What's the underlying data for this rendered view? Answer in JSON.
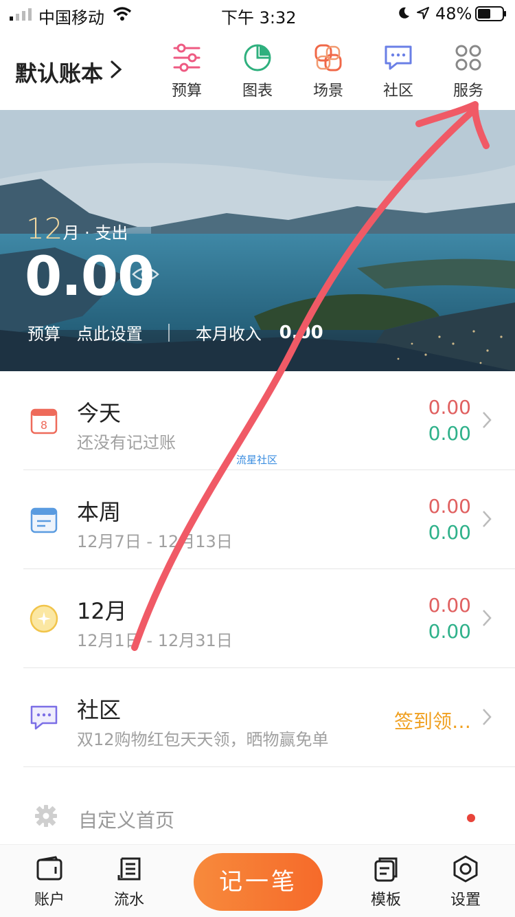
{
  "status_bar": {
    "carrier": "中国移动",
    "time": "下午 3:32",
    "battery": "48%"
  },
  "header": {
    "book_title": "默认账本",
    "nav": [
      {
        "label": "预算",
        "icon": "sliders-icon"
      },
      {
        "label": "图表",
        "icon": "pie-chart-icon"
      },
      {
        "label": "场景",
        "icon": "scene-icon"
      },
      {
        "label": "社区",
        "icon": "chat-bubble-icon"
      },
      {
        "label": "服务",
        "icon": "grid-command-icon"
      }
    ]
  },
  "banner": {
    "month_num": "12",
    "month_suffix": "月 · 支出",
    "expense": "0.00",
    "budget_label": "预算",
    "budget_action": "点此设置",
    "income_label": "本月收入",
    "income_value": "0.00"
  },
  "rows": [
    {
      "title": "今天",
      "sub": "还没有记过账",
      "expense": "0.00",
      "income": "0.00",
      "icon": "calendar-day-icon"
    },
    {
      "title": "本周",
      "sub": "12月7日 - 12月13日",
      "expense": "0.00",
      "income": "0.00",
      "icon": "calendar-week-icon"
    },
    {
      "title": "12月",
      "sub": "12月1日 - 12月31日",
      "expense": "0.00",
      "income": "0.00",
      "icon": "moon-star-icon"
    },
    {
      "title": "社区",
      "sub": "双12购物红包天天领，晒物赢免单",
      "promo": "签到领…",
      "icon": "community-icon"
    }
  ],
  "watermark": "流星社区",
  "custom_home": "自定义首页",
  "tabbar": {
    "tabs": [
      {
        "label": "账户",
        "icon": "wallet-icon"
      },
      {
        "label": "流水",
        "icon": "ledger-icon"
      },
      {
        "label": "模板",
        "icon": "template-icon"
      },
      {
        "label": "设置",
        "icon": "settings-hex-icon"
      }
    ],
    "record": "记一笔"
  },
  "colors": {
    "expense": "#e06060",
    "income": "#2fb18a",
    "accent": "#f66a2a",
    "promo": "#f0a020",
    "annotation": "#f05a66"
  }
}
